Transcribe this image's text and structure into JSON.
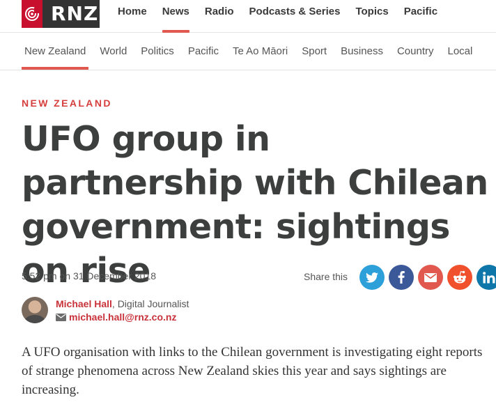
{
  "brand": {
    "name": "RNZ",
    "accent": "#e0584e",
    "logo_icon": "rnz-radio-wave-icon"
  },
  "primary_nav": [
    {
      "label": "Home",
      "active": false
    },
    {
      "label": "News",
      "active": true
    },
    {
      "label": "Radio",
      "active": false
    },
    {
      "label": "Podcasts & Series",
      "active": false
    },
    {
      "label": "Topics",
      "active": false
    },
    {
      "label": "Pacific",
      "active": false
    }
  ],
  "secondary_nav": [
    {
      "label": "New Zealand",
      "active": true
    },
    {
      "label": "World",
      "active": false
    },
    {
      "label": "Politics",
      "active": false
    },
    {
      "label": "Pacific",
      "active": false
    },
    {
      "label": "Te Ao Māori",
      "active": false
    },
    {
      "label": "Sport",
      "active": false
    },
    {
      "label": "Business",
      "active": false
    },
    {
      "label": "Country",
      "active": false
    },
    {
      "label": "Local",
      "active": false
    }
  ],
  "article": {
    "section": "NEW ZEALAND",
    "headline": "UFO group in partnership with Chilean government: sightings on rise",
    "date": "5:52 pm on 31 December 2018",
    "author_name": "Michael Hall",
    "author_role": ", Digital Journalist",
    "author_email": "michael.hall@rnz.co.nz",
    "body": "A UFO organisation with links to the Chilean government is investigating eight reports of strange phenomena across New Zealand skies this year and says sightings are increasing."
  },
  "share": {
    "label": "Share this",
    "buttons": [
      {
        "icon": "twitter-icon",
        "color": "#2d9fd9"
      },
      {
        "icon": "facebook-icon",
        "color": "#3b5998"
      },
      {
        "icon": "email-icon",
        "color": "#e0584e"
      },
      {
        "icon": "reddit-icon",
        "color": "#f0512c"
      },
      {
        "icon": "linkedin-icon",
        "color": "#0e76a8"
      }
    ]
  }
}
